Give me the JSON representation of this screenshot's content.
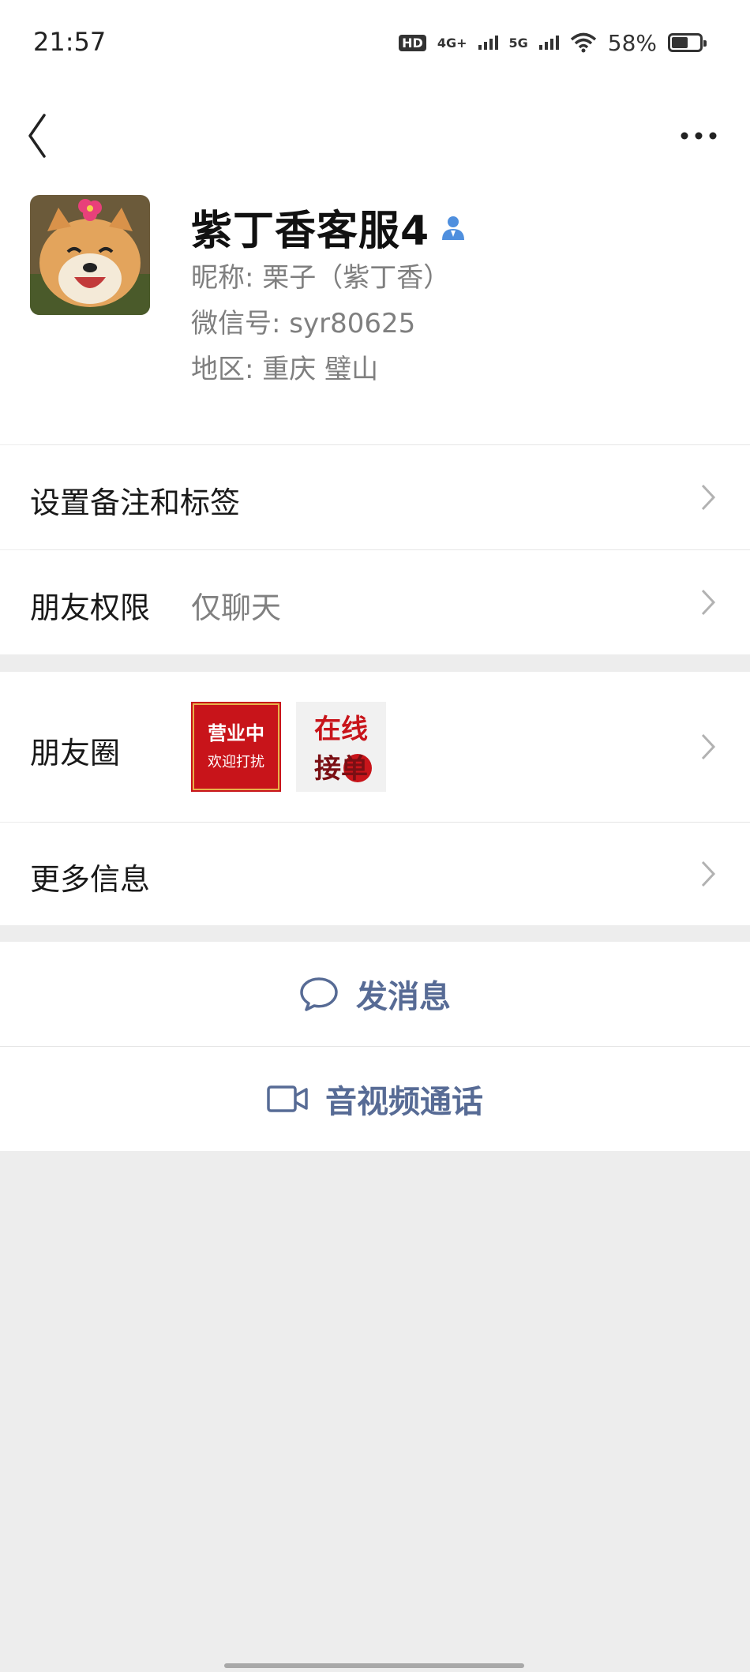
{
  "status_bar": {
    "time": "21:57",
    "hd_label": "HD",
    "net1": "4G+",
    "net2": "5G",
    "battery": "58%",
    "battery_level": 0.58
  },
  "nav": {
    "back_icon": "chevron-left-icon",
    "more_icon": "more-dots-icon"
  },
  "profile": {
    "name": "紫丁香客服4",
    "nickname_label": "昵称:",
    "nickname": "栗子（紫丁香）",
    "wechat_id_label": "微信号:",
    "wechat_id": "syr80625",
    "region_label": "地区:",
    "region": "重庆 璧山"
  },
  "menu": {
    "remark": "设置备注和标签",
    "permission_label": "朋友权限",
    "permission_value": "仅聊天",
    "moments_label": "朋友圈",
    "moments_thumb1_lines": [
      "营业中",
      "欢迎打扰"
    ],
    "moments_thumb2_lines": [
      "在线",
      "接单"
    ],
    "more_info": "更多信息"
  },
  "actions": {
    "send_message": "发消息",
    "video_call": "音视频通话"
  },
  "colors": {
    "link": "#576b95",
    "background": "#ededed",
    "verified": "#4f8fde"
  }
}
